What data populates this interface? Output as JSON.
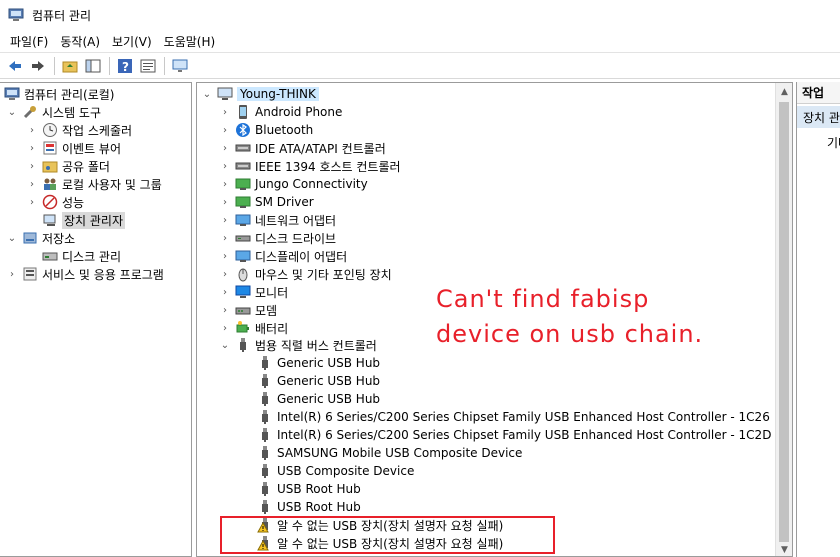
{
  "window": {
    "title": "컴퓨터 관리"
  },
  "menu": [
    "파일(F)",
    "동작(A)",
    "보기(V)",
    "도움말(H)"
  ],
  "toolbar": {
    "buttons": [
      "back-arrow-icon",
      "forward-arrow-icon",
      "folder-up-icon",
      "show-hide-tree-icon",
      "help-icon",
      "properties-icon",
      "monitor-icon"
    ]
  },
  "left_tree": {
    "root": "컴퓨터 관리(로컬)",
    "system_tools": "시스템 도구",
    "task_scheduler": "작업 스케줄러",
    "event_viewer": "이벤트 뷰어",
    "shared_folders": "공유 폴더",
    "local_users": "로컬 사용자 및 그룹",
    "performance": "성능",
    "device_manager": "장치 관리자",
    "storage": "저장소",
    "disk_management": "디스크 관리",
    "services": "서비스 및 응용 프로그램"
  },
  "devices": {
    "root": "Young-THINK",
    "categories": [
      "Android Phone",
      "Bluetooth",
      "IDE ATA/ATAPI 컨트롤러",
      "IEEE 1394 호스트 컨트롤러",
      "Jungo Connectivity",
      "SM Driver",
      "네트워크 어댑터",
      "디스크 드라이브",
      "디스플레이 어댑터",
      "마우스 및 기타 포인팅 장치",
      "모니터",
      "모뎀",
      "배터리"
    ],
    "usb_category": "범용 직렬 버스 컨트롤러",
    "usb_children": [
      "Generic USB Hub",
      "Generic USB Hub",
      "Generic USB Hub",
      "Intel(R) 6 Series/C200 Series Chipset Family USB Enhanced Host Controller - 1C26",
      "Intel(R) 6 Series/C200 Series Chipset Family USB Enhanced Host Controller - 1C2D",
      "SAMSUNG Mobile USB Composite Device",
      "USB Composite Device",
      "USB Root Hub",
      "USB Root Hub"
    ],
    "unknown_devices": [
      "알 수 없는 USB 장치(장치 설명자 요청 실패)",
      "알 수 없는 USB 장치(장치 설명자 요청 실패)"
    ]
  },
  "annotation": {
    "line1": "Can't find fabisp",
    "line2": "device on usb chain."
  },
  "actions_pane": {
    "header": "작업",
    "section": "장치 관리자",
    "more": "기타 작업"
  },
  "colors": {
    "annotation_red": "#e8202a",
    "selection": "#cce8ff"
  }
}
